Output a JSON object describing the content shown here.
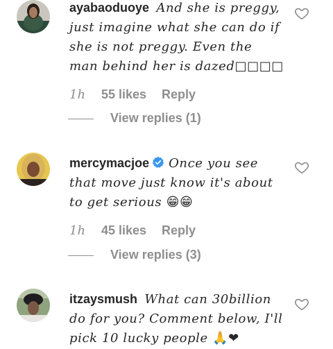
{
  "comments": [
    {
      "username": "ayabaoduoye",
      "verified": false,
      "text": "And she is preggy, just imagine what she can do if she is not preggy. Even the man behind her is dazed",
      "text_suffix": "□□□□",
      "time": "1h",
      "likes": "55 likes",
      "reply_label": "Reply",
      "view_replies": "View replies (1)",
      "avatar_icon": "avatar-woman-green-dress"
    },
    {
      "username": "mercymacjoe",
      "verified": true,
      "text": "Once you see that move just know it's about to get serious",
      "text_suffix": "😁😁",
      "time": "1h",
      "likes": "45 likes",
      "reply_label": "Reply",
      "view_replies": "View replies (3)",
      "avatar_icon": "avatar-woman-blonde"
    },
    {
      "username": "itzaysmush",
      "verified": false,
      "text": "What can 30billion do for you? Comment below, I'll pick 10 lucky people",
      "text_suffix": "🙏❤",
      "avatar_icon": "avatar-woman-hat"
    }
  ],
  "icons": {
    "like": "heart-outline-icon",
    "verified": "verified-badge-icon"
  },
  "colors": {
    "text": "#262626",
    "secondary": "#8e8e8e",
    "verified": "#3897f0"
  }
}
